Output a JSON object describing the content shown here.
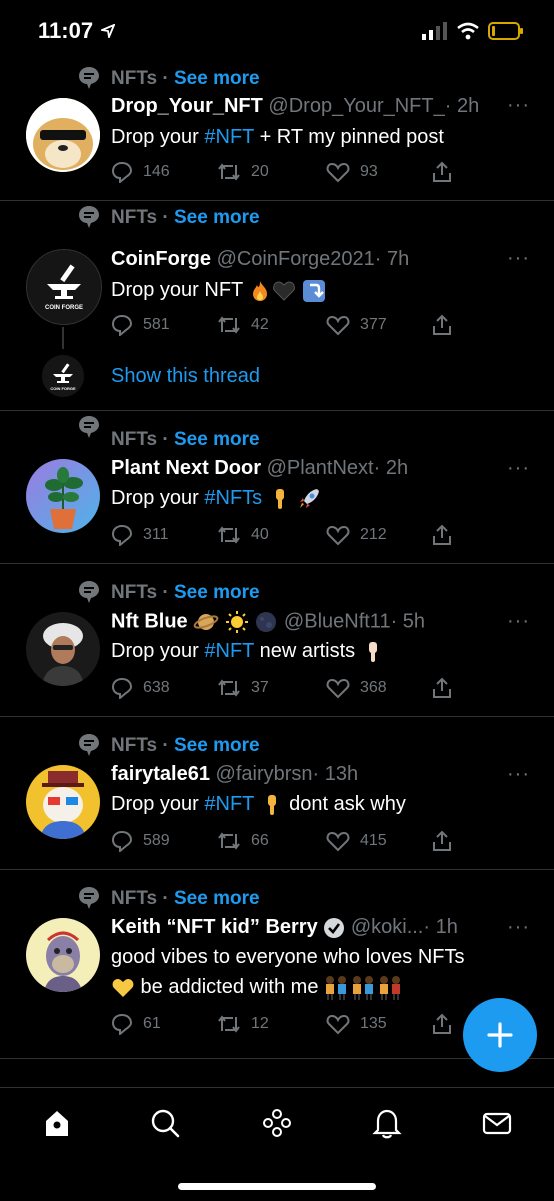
{
  "status": {
    "time": "11:07"
  },
  "tweets": [
    {
      "topic": "NFTs",
      "see_more": "See more",
      "name": "Drop_Your_NFT",
      "handle": "@Drop_Your_NFT_",
      "time": "· 2h",
      "text_before": "Drop your ",
      "hashtag": "#NFT",
      "text_after": " + RT my pinned post",
      "replies": "146",
      "retweets": "20",
      "likes": "93"
    },
    {
      "topic": "NFTs",
      "see_more": "See more",
      "name": "CoinForge",
      "handle": "@CoinForge2021",
      "time": "· 7h",
      "text": "Drop your NFT",
      "avatar_text": "COIN FORGE",
      "avatar_text_small": "COIN FORGE",
      "replies": "581",
      "retweets": "42",
      "likes": "377",
      "thread_link": "Show this thread"
    },
    {
      "topic": "NFTs",
      "see_more": "See more",
      "name": "Plant Next Door",
      "handle": "@PlantNext",
      "time": "· 2h",
      "text_before": "Drop your ",
      "hashtag": "#NFTs",
      "replies": "311",
      "retweets": "40",
      "likes": "212"
    },
    {
      "topic": "NFTs",
      "see_more": "See more",
      "name": "Nft Blue",
      "handle": "@BlueNft11",
      "time": "· 5h",
      "text_before": "Drop your ",
      "hashtag": "#NFT",
      "text_after": " new artists",
      "replies": "638",
      "retweets": "37",
      "likes": "368"
    },
    {
      "topic": "NFTs",
      "see_more": "See more",
      "name": "fairytale61",
      "handle": "@fairybrsn",
      "time": "· 13h",
      "text_before": "Drop your ",
      "hashtag": "#NFT",
      "text_after": " dont ask why",
      "replies": "589",
      "retweets": "66",
      "likes": "415"
    },
    {
      "topic": "NFTs",
      "see_more": "See more",
      "name": "Keith “NFT kid” Berry",
      "handle": "@koki...",
      "time": "· 1h",
      "line1": "good vibes to everyone who loves NFTs",
      "line2": " be addicted with me",
      "replies": "61",
      "retweets": "12",
      "likes": "135"
    }
  ],
  "colors": {
    "accent": "#1d9bf0",
    "muted": "#71767b",
    "divider": "#2f3336",
    "background": "#000000"
  },
  "icons": {
    "fab": "compose-plus-icon",
    "tabs": [
      "home-icon",
      "search-icon",
      "spaces-icon",
      "notifications-icon",
      "messages-icon"
    ]
  }
}
